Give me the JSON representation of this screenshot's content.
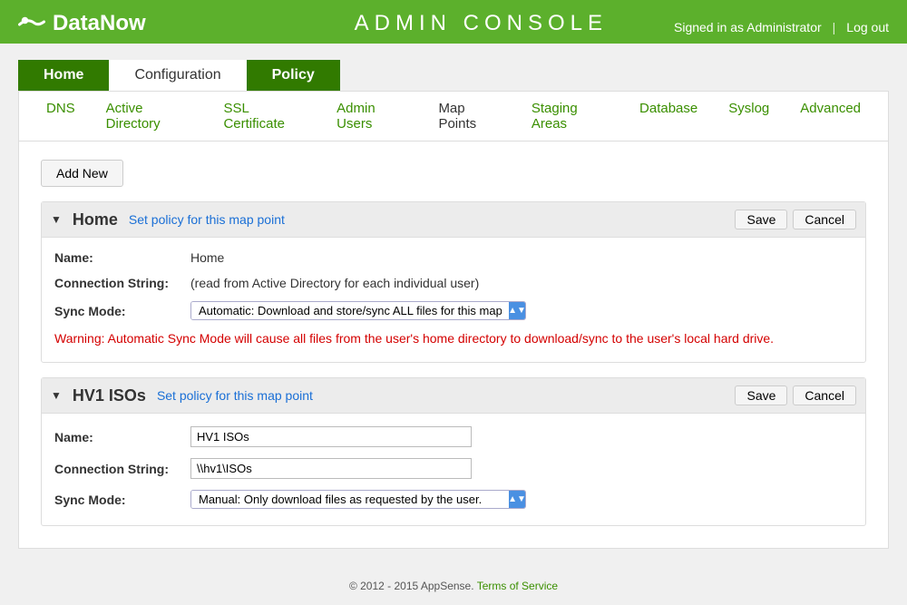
{
  "header": {
    "brand": "DataNow",
    "title": "ADMIN CONSOLE",
    "signed_in": "Signed in as Administrator",
    "logout": "Log out"
  },
  "tabs": {
    "home": "Home",
    "configuration": "Configuration",
    "policy": "Policy"
  },
  "subnav": {
    "dns": "DNS",
    "ad": "Active Directory",
    "ssl": "SSL Certificate",
    "admin_users": "Admin Users",
    "map_points": "Map Points",
    "staging": "Staging Areas",
    "database": "Database",
    "syslog": "Syslog",
    "advanced": "Advanced"
  },
  "buttons": {
    "add_new": "Add New",
    "save": "Save",
    "cancel": "Cancel"
  },
  "labels": {
    "name": "Name:",
    "connection_string": "Connection String:",
    "sync_mode": "Sync Mode:",
    "set_policy": "Set policy for this map point"
  },
  "map_points": [
    {
      "title": "Home",
      "name_value": "Home",
      "connection_string": "(read from Active Directory for each individual user)",
      "sync_mode_value": "Automatic: Download and store/sync ALL files for this map point.",
      "warning": "Warning: Automatic Sync Mode will cause all files from the user's home directory to download/sync to the user's local hard drive.",
      "readonly": true
    },
    {
      "title": "HV1 ISOs",
      "name_value": "HV1 ISOs",
      "connection_string": "\\\\hv1\\ISOs",
      "sync_mode_value": "Manual: Only download files as requested by the user.",
      "readonly": false
    }
  ],
  "footer": {
    "copyright": "© 2012 - 2015 AppSense.",
    "tos": "Terms of Service"
  }
}
